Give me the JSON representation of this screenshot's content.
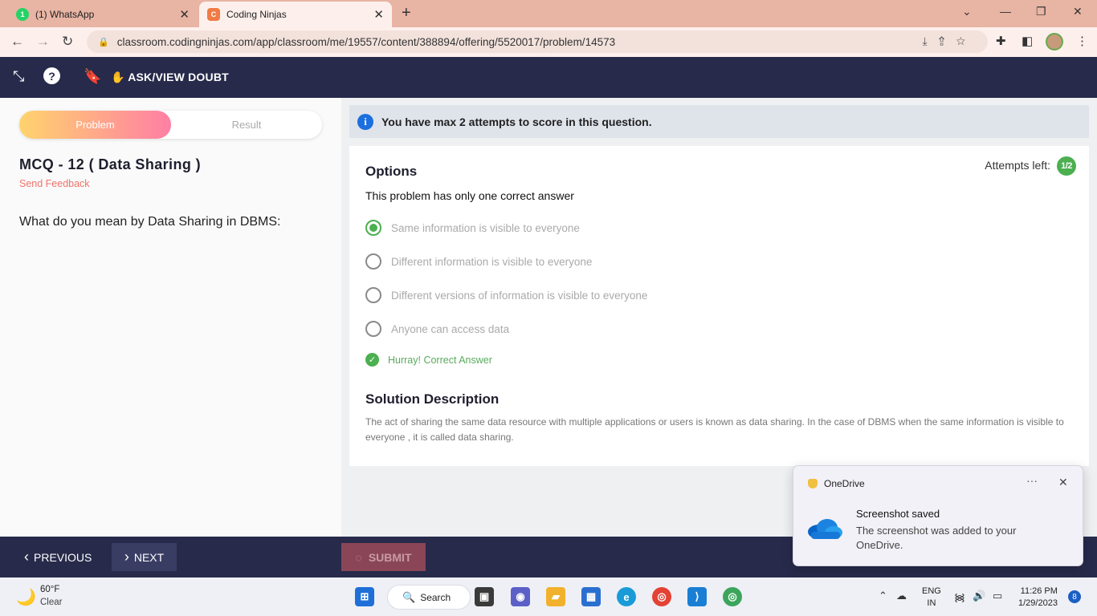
{
  "browser": {
    "tabs": [
      {
        "title": "(1) WhatsApp",
        "icon": "whatsapp-icon",
        "favicon_text": "1"
      },
      {
        "title": "Coding Ninjas",
        "icon": "coding-ninjas-icon",
        "favicon_text": "C"
      }
    ],
    "url": "classroom.codingninjas.com/app/classroom/me/19557/content/388894/offering/5520017/problem/14573"
  },
  "app_header": {
    "ask_doubt_label": "ASK/VIEW DOUBT"
  },
  "left": {
    "tabs": {
      "problem": "Problem",
      "result": "Result"
    },
    "question_title": "MCQ - 12 ( Data Sharing )",
    "send_feedback": "Send Feedback",
    "question_text": "What do you mean by Data Sharing in DBMS:"
  },
  "info_bar": {
    "text": "You have max 2 attempts to score in this question."
  },
  "options_card": {
    "heading": "Options",
    "attempts_label": "Attempts left:",
    "attempts_value": "1/2",
    "subheading": "This problem has only one correct answer",
    "options": [
      {
        "label": "Same information is visible to everyone",
        "selected": true
      },
      {
        "label": "Different information is visible to everyone",
        "selected": false
      },
      {
        "label": "Different versions of information is visible to everyone",
        "selected": false
      },
      {
        "label": "Anyone can access data",
        "selected": false
      }
    ],
    "result_message": "Hurray! Correct Answer",
    "solution_heading": "Solution Description",
    "solution_text": "The act of sharing the same data resource with multiple applications or users is known as data sharing. In the case of DBMS when the same information is visible to everyone , it is called data sharing."
  },
  "bottom_bar": {
    "previous_label": "PREVIOUS",
    "next_label": "NEXT",
    "submit_label": "SUBMIT"
  },
  "toast": {
    "app_name": "OneDrive",
    "title": "Screenshot saved",
    "body": "The screenshot was added to your OneDrive."
  },
  "taskbar": {
    "temperature": "60°F",
    "weather": "Clear",
    "search_label": "Search",
    "lang_line1": "ENG",
    "lang_line2": "IN",
    "time": "11:26 PM",
    "date": "1/29/2023",
    "notification_count": "8"
  },
  "colors": {
    "accent_green": "#4caf50",
    "header_navy": "#272a4a",
    "info_blue": "#1b6fde",
    "feedback_coral": "#f0736a"
  }
}
